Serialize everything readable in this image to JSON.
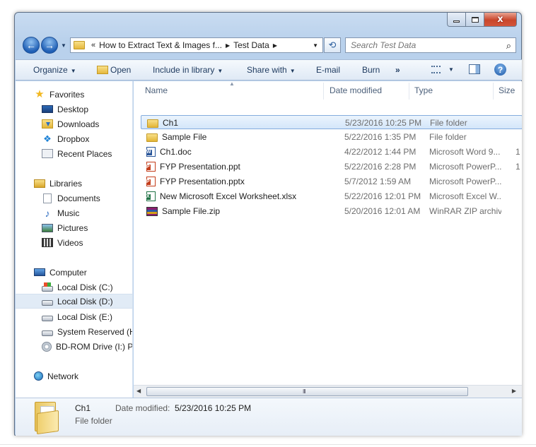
{
  "window": {
    "caption": {
      "minimize": "minimize",
      "maximize": "maximize",
      "close": "x"
    }
  },
  "address": {
    "overflow": "«",
    "crumbs": [
      "How to Extract Text & Images f...",
      "Test Data"
    ]
  },
  "search": {
    "placeholder": "Search Test Data"
  },
  "toolbar": {
    "organize": "Organize",
    "open": "Open",
    "include_in_library": "Include in library",
    "share_with": "Share with",
    "email": "E-mail",
    "burn": "Burn",
    "more": "»"
  },
  "navpane": {
    "favorites": {
      "label": "Favorites",
      "items": [
        "Desktop",
        "Downloads",
        "Dropbox",
        "Recent Places"
      ]
    },
    "libraries": {
      "label": "Libraries",
      "items": [
        "Documents",
        "Music",
        "Pictures",
        "Videos"
      ]
    },
    "computer": {
      "label": "Computer",
      "items": [
        "Local Disk (C:)",
        "Local Disk (D:)",
        "Local Disk (E:)",
        "System Reserved (H:",
        "BD-ROM Drive (I:) P:"
      ],
      "selected": "Local Disk (D:)"
    },
    "network": {
      "label": "Network"
    }
  },
  "columns": {
    "name": "Name",
    "date": "Date modified",
    "type": "Type",
    "size": "Size"
  },
  "files": [
    {
      "name": "Ch1",
      "date": "5/23/2016 10:25 PM",
      "type": "File folder",
      "size": "",
      "icon": "folder-icon",
      "selected": true
    },
    {
      "name": "Sample File",
      "date": "5/22/2016 1:35 PM",
      "type": "File folder",
      "size": "",
      "icon": "folder-icon"
    },
    {
      "name": "Ch1.doc",
      "date": "4/22/2012 1:44 PM",
      "type": "Microsoft Word 9...",
      "size": "1",
      "icon": "word-doc-icon"
    },
    {
      "name": "FYP Presentation.ppt",
      "date": "5/22/2016 2:28 PM",
      "type": "Microsoft PowerP...",
      "size": "1",
      "icon": "powerpoint-icon"
    },
    {
      "name": "FYP Presentation.pptx",
      "date": "5/7/2012 1:59 AM",
      "type": "Microsoft PowerP...",
      "size": "",
      "icon": "powerpoint-icon"
    },
    {
      "name": "New Microsoft Excel Worksheet.xlsx",
      "date": "5/22/2016 12:01 PM",
      "type": "Microsoft Excel W...",
      "size": "",
      "icon": "excel-icon"
    },
    {
      "name": "Sample File.zip",
      "date": "5/20/2016 12:01 AM",
      "type": "WinRAR ZIP archive",
      "size": "",
      "icon": "winrar-archive-icon"
    }
  ],
  "details": {
    "name": "Ch1",
    "type": "File folder",
    "date_label": "Date modified:",
    "date_value": "5/23/2016 10:25 PM"
  },
  "scrollbar": {
    "grip": "III"
  }
}
